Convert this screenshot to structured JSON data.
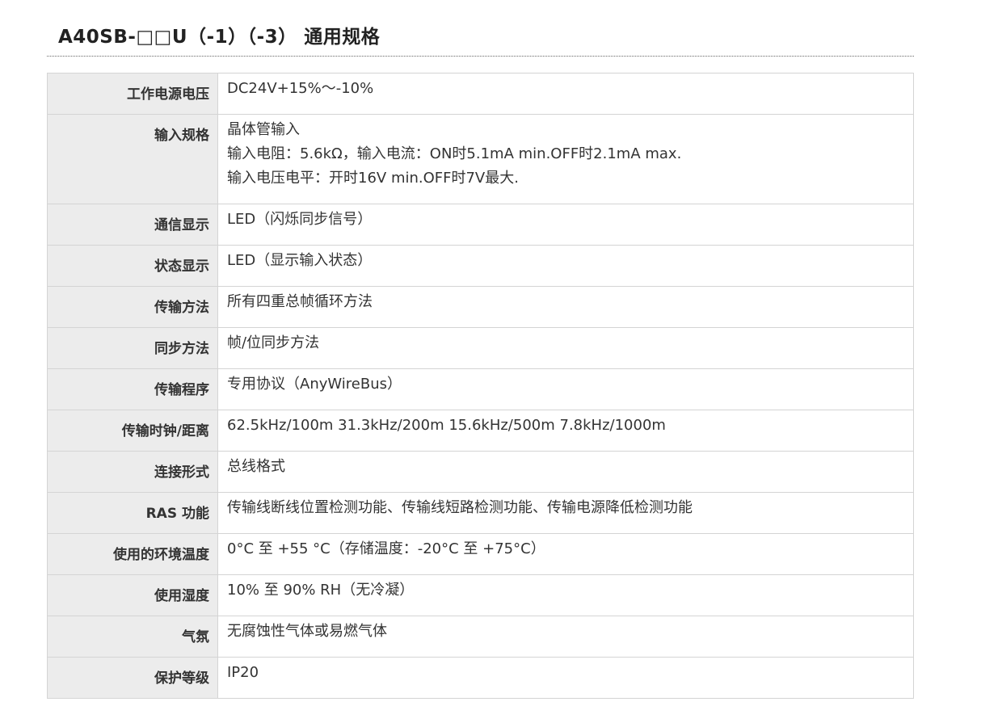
{
  "title": "A40SB-□□U（-1）（-3） 通用规格",
  "specs": {
    "rows": [
      {
        "label": "工作电源电压",
        "lines": [
          "DC24V+15%～-10%"
        ]
      },
      {
        "label": "输入规格",
        "lines": [
          "晶体管输入",
          "输入电阻：5.6kΩ，输入电流：ON时5.1mA min.OFF时2.1mA max.",
          "输入电压电平：开时16V min.OFF时7V最大."
        ]
      },
      {
        "label": "通信显示",
        "lines": [
          "LED（闪烁同步信号）"
        ]
      },
      {
        "label": "状态显示",
        "lines": [
          "LED（显示输入状态）"
        ]
      },
      {
        "label": "传输方法",
        "lines": [
          "所有四重总帧循环方法"
        ]
      },
      {
        "label": "同步方法",
        "lines": [
          "帧/位同步方法"
        ]
      },
      {
        "label": "传输程序",
        "lines": [
          "专用协议（AnyWireBus）"
        ]
      },
      {
        "label": "传输时钟/距离",
        "lines": [
          "62.5kHz/100m 31.3kHz/200m 15.6kHz/500m 7.8kHz/1000m"
        ]
      },
      {
        "label": "连接形式",
        "lines": [
          "总线格式"
        ]
      },
      {
        "label": "RAS 功能",
        "lines": [
          "传输线断线位置检测功能、传输线短路检测功能、传输电源降低检测功能"
        ]
      },
      {
        "label": "使用的环境温度",
        "lines": [
          "0°C 至 +55 °C（存储温度：-20°C 至 +75°C）"
        ]
      },
      {
        "label": "使用湿度",
        "lines": [
          "10% 至 90% RH（无冷凝）"
        ]
      },
      {
        "label": "气氛",
        "lines": [
          "无腐蚀性气体或易燃气体"
        ]
      },
      {
        "label": "保护等级",
        "lines": [
          "IP20"
        ]
      }
    ]
  }
}
